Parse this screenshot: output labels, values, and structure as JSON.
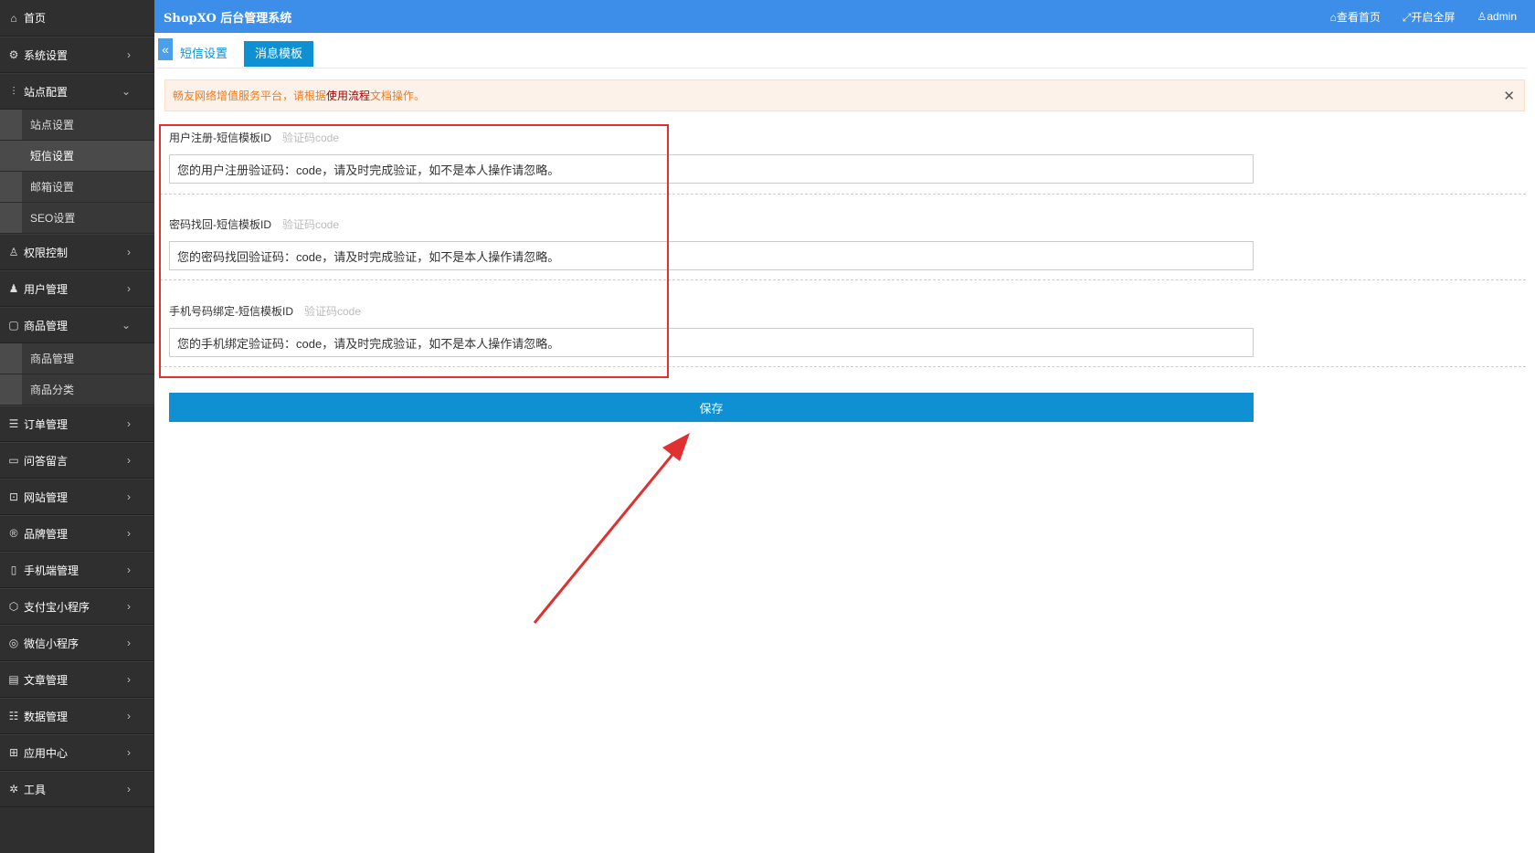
{
  "sidebar": {
    "items": [
      {
        "label": "首页",
        "icon": "home-icon"
      },
      {
        "label": "系统设置",
        "icon": "gear-icon"
      },
      {
        "label": "站点配置",
        "icon": "sliders-icon"
      },
      {
        "label": "权限控制",
        "icon": "user-lock-icon"
      },
      {
        "label": "用户管理",
        "icon": "users-icon"
      },
      {
        "label": "商品管理",
        "icon": "box-icon"
      },
      {
        "label": "订单管理",
        "icon": "list-icon"
      },
      {
        "label": "问答留言",
        "icon": "message-icon"
      },
      {
        "label": "网站管理",
        "icon": "website-icon"
      },
      {
        "label": "品牌管理",
        "icon": "brand-icon"
      },
      {
        "label": "手机端管理",
        "icon": "mobile-icon"
      },
      {
        "label": "支付宝小程序",
        "icon": "alipay-icon"
      },
      {
        "label": "微信小程序",
        "icon": "wechat-icon"
      },
      {
        "label": "文章管理",
        "icon": "article-icon"
      },
      {
        "label": "数据管理",
        "icon": "database-icon"
      },
      {
        "label": "应用中心",
        "icon": "apps-icon"
      },
      {
        "label": "工具",
        "icon": "tools-icon"
      }
    ],
    "site_sub": [
      "站点设置",
      "短信设置",
      "邮箱设置",
      "SEO设置"
    ],
    "goods_sub": [
      "商品管理",
      "商品分类"
    ]
  },
  "header": {
    "title": "ShopXO 后台管理系统",
    "view_home": "查看首页",
    "fullscreen": "开启全屏",
    "user": "admin"
  },
  "tabs": {
    "sms_settings": "短信设置",
    "message_template": "消息模板"
  },
  "alert": {
    "prefix": "畅友网络增值服务平台，请根据",
    "link": "使用流程",
    "suffix": "文档操作。"
  },
  "form": {
    "fields": [
      {
        "label": "用户注册-短信模板ID",
        "tip": "验证码code",
        "value": "您的用户注册验证码：code，请及时完成验证，如不是本人操作请忽略。"
      },
      {
        "label": "密码找回-短信模板ID",
        "tip": "验证码code",
        "value": "您的密码找回验证码：code，请及时完成验证，如不是本人操作请忽略。"
      },
      {
        "label": "手机号码绑定-短信模板ID",
        "tip": "验证码code",
        "value": "您的手机绑定验证码：code，请及时完成验证，如不是本人操作请忽略。"
      }
    ],
    "save_label": "保存"
  },
  "colors": {
    "header": "#3d8ee8",
    "primary": "#0e90d2",
    "annotation": "#e03030",
    "sidebar": "#2f2f2f"
  }
}
